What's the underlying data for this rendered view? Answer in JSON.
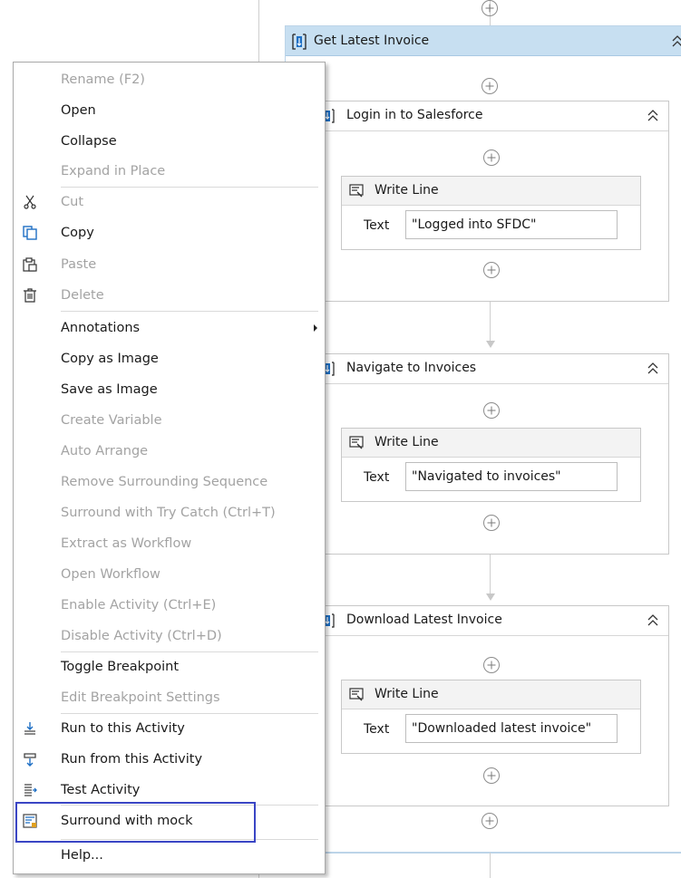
{
  "designer": {
    "outer_sequence": {
      "title": "Get Latest Invoice"
    },
    "sequences": [
      {
        "title": "Login in to Salesforce",
        "write_line": {
          "title": "Write Line",
          "text_label": "Text",
          "text_value": "\"Logged into SFDC\""
        }
      },
      {
        "title": "Navigate to Invoices",
        "write_line": {
          "title": "Write Line",
          "text_label": "Text",
          "text_value": "\"Navigated to invoices\""
        }
      },
      {
        "title": "Download Latest Invoice",
        "write_line": {
          "title": "Write Line",
          "text_label": "Text",
          "text_value": "\"Downloaded latest invoice\""
        }
      }
    ],
    "colors": {
      "outer_header": "#c7dff1",
      "sequence_icon": "#1e6fc4",
      "highlight_border": "#3a45c4"
    }
  },
  "context_menu": {
    "items": [
      {
        "label": "Rename (F2)",
        "enabled": false,
        "icon": ""
      },
      {
        "label": "Open",
        "enabled": true,
        "icon": ""
      },
      {
        "label": "Collapse",
        "enabled": true,
        "icon": ""
      },
      {
        "label": "Expand in Place",
        "enabled": false,
        "icon": ""
      },
      {
        "label": "Cut",
        "enabled": false,
        "icon": "scissors-icon"
      },
      {
        "label": "Copy",
        "enabled": true,
        "icon": "copy-icon"
      },
      {
        "label": "Paste",
        "enabled": false,
        "icon": "clipboard-icon"
      },
      {
        "label": "Delete",
        "enabled": false,
        "icon": "trash-icon"
      },
      {
        "label": "Annotations",
        "enabled": true,
        "icon": "",
        "submenu": true
      },
      {
        "label": "Copy as Image",
        "enabled": true,
        "icon": ""
      },
      {
        "label": "Save as Image",
        "enabled": true,
        "icon": ""
      },
      {
        "label": "Create Variable",
        "enabled": false,
        "icon": ""
      },
      {
        "label": "Auto Arrange",
        "enabled": false,
        "icon": ""
      },
      {
        "label": "Remove Surrounding Sequence",
        "enabled": false,
        "icon": ""
      },
      {
        "label": "Surround with Try Catch (Ctrl+T)",
        "enabled": false,
        "icon": ""
      },
      {
        "label": "Extract as Workflow",
        "enabled": false,
        "icon": ""
      },
      {
        "label": "Open Workflow",
        "enabled": false,
        "icon": ""
      },
      {
        "label": "Enable Activity (Ctrl+E)",
        "enabled": false,
        "icon": ""
      },
      {
        "label": "Disable Activity (Ctrl+D)",
        "enabled": false,
        "icon": ""
      },
      {
        "label": "Toggle Breakpoint",
        "enabled": true,
        "icon": ""
      },
      {
        "label": "Edit Breakpoint Settings",
        "enabled": false,
        "icon": ""
      },
      {
        "label": "Run to this Activity",
        "enabled": true,
        "icon": "run-to-icon"
      },
      {
        "label": "Run from this Activity",
        "enabled": true,
        "icon": "run-from-icon"
      },
      {
        "label": "Test Activity",
        "enabled": true,
        "icon": "test-activity-icon"
      },
      {
        "label": "Surround with mock",
        "enabled": true,
        "icon": "mock-icon",
        "highlighted": true
      },
      {
        "label": "Help...",
        "enabled": true,
        "icon": ""
      }
    ]
  }
}
